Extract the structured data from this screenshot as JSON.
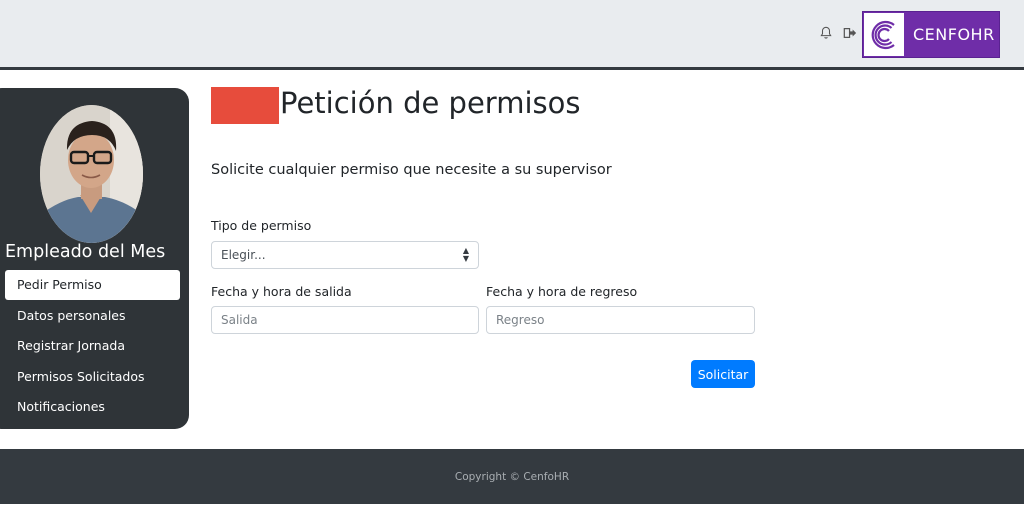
{
  "header": {
    "brand_name": "CENFOHR",
    "icons": [
      "bell-icon",
      "sign-out-icon"
    ],
    "brand_color": "#6f2da8"
  },
  "sidebar": {
    "title": "Empleado del Mes",
    "menu": [
      {
        "label": "Pedir Permiso",
        "active": true
      },
      {
        "label": "Datos personales",
        "active": false
      },
      {
        "label": "Registrar Jornada",
        "active": false
      },
      {
        "label": "Permisos Solicitados",
        "active": false
      },
      {
        "label": "Notificaciones",
        "active": false
      }
    ]
  },
  "main": {
    "title": "Petición de permisos",
    "subtitle": "Solicite cualquier permiso que necesite a su supervisor",
    "permit_type": {
      "label": "Tipo de permiso",
      "selected": "Elegir..."
    },
    "departure": {
      "label": "Fecha y hora de salida",
      "placeholder": "Salida",
      "value": ""
    },
    "return": {
      "label": "Fecha y hora de regreso",
      "placeholder": "Regreso",
      "value": ""
    },
    "submit_label": "Solicitar",
    "accent_color": "#e74c3c",
    "button_color": "#007bff"
  },
  "footer": {
    "copyright": "Copyright © CenfoHR"
  }
}
